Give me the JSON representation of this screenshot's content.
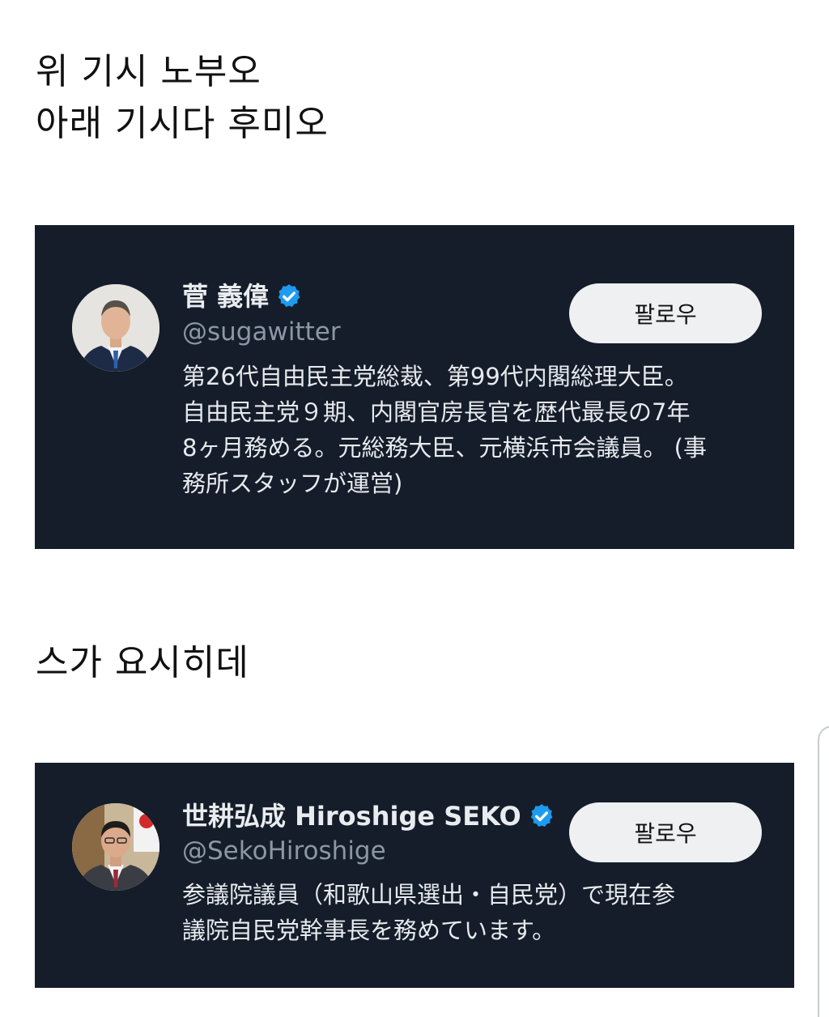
{
  "captions": {
    "line1": "위 기시 노부오",
    "line2": "아래 기시다 후미오",
    "line3": "스가 요시히데"
  },
  "cards": [
    {
      "name": "菅 義偉",
      "handle": "@sugawitter",
      "follow_label": "팔로우",
      "verified_icon": "verified-badge-icon",
      "bio_lines": [
        "第26代自由民主党総裁、第99代内閣総理大臣。",
        "自由民主党９期、内閣官房長官を歴代最長の7年",
        "8ヶ月務める。元総務大臣、元横浜市会議員。 (事",
        "務所スタッフが運営)"
      ]
    },
    {
      "name": "世耕弘成 Hiroshige SEKO",
      "handle": "@SekoHiroshige",
      "follow_label": "팔로우",
      "verified_icon": "verified-badge-icon",
      "bio_lines": [
        "参議院議員（和歌山県選出・自民党）で現在参",
        "議院自民党幹事長を務めています。"
      ]
    }
  ],
  "colors": {
    "card_background": "#151d2a",
    "verified_blue": "#1d9bf0",
    "follow_button": "#eef0f2"
  }
}
